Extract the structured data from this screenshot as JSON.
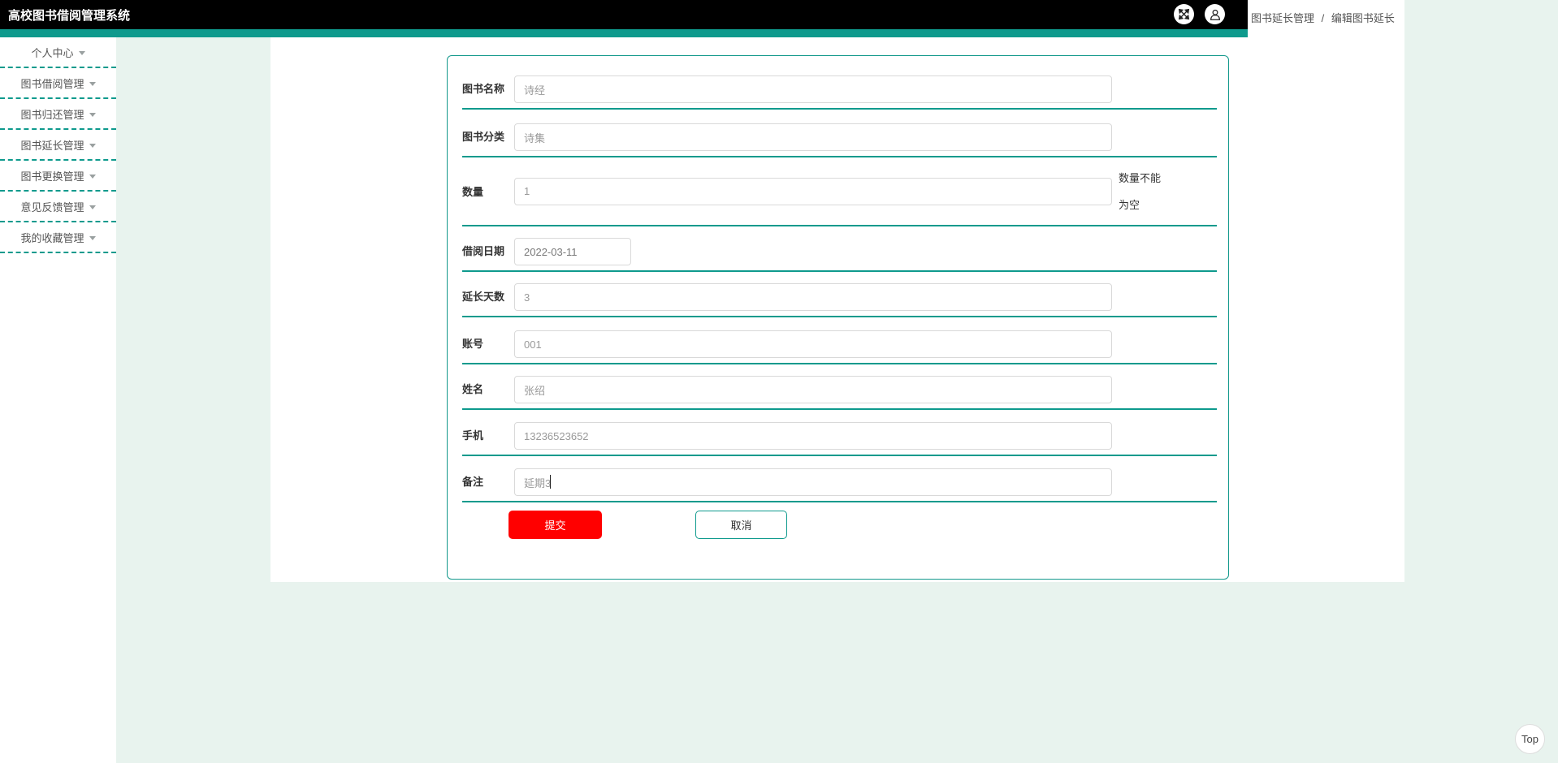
{
  "header": {
    "title": "高校图书借阅管理系统",
    "breadcrumb": {
      "section": "图书延长管理",
      "separator": "/",
      "page": "编辑图书延长"
    },
    "icons": {
      "fullscreen": "fullscreen-toggle-icon",
      "user": "user-avatar-icon"
    }
  },
  "sidebar": {
    "items": [
      {
        "label": "个人中心"
      },
      {
        "label": "图书借阅管理"
      },
      {
        "label": "图书归还管理"
      },
      {
        "label": "图书延长管理"
      },
      {
        "label": "图书更换管理"
      },
      {
        "label": "意见反馈管理"
      },
      {
        "label": "我的收藏管理"
      }
    ]
  },
  "form": {
    "fields": [
      {
        "label": "图书名称",
        "value": "诗经"
      },
      {
        "label": "图书分类",
        "value": "诗集"
      },
      {
        "label": "数量",
        "value": "1",
        "error": "数量不能为空"
      },
      {
        "label": "借阅日期",
        "value": "2022-03-11"
      },
      {
        "label": "延长天数",
        "value": "3"
      },
      {
        "label": "账号",
        "value": "001"
      },
      {
        "label": "姓名",
        "value": "张绍"
      },
      {
        "label": "手机",
        "value": "13236523652"
      },
      {
        "label": "备注",
        "value": "延期3"
      }
    ],
    "submit_label": "提交",
    "cancel_label": "取消"
  },
  "back_to_top": "Top",
  "colors": {
    "accent_teal": "#0e9a8d",
    "submit_red": "#ff0000",
    "page_bg": "#e8f3ee",
    "topbar_black": "#000000"
  }
}
